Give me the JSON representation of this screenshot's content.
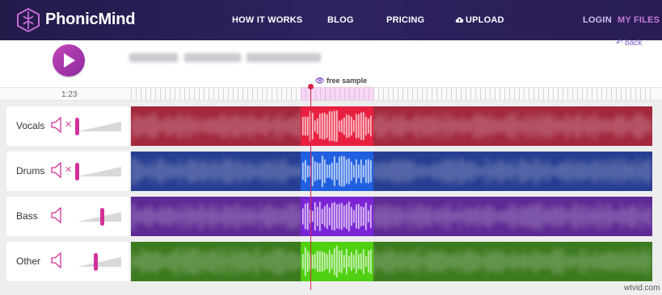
{
  "header": {
    "brand": "PhonicMind",
    "nav": {
      "how_it_works": "HOW IT WORKS",
      "blog": "BLOG",
      "pricing": "PRICING",
      "upload": "UPLOAD"
    },
    "login": "LOGIN",
    "my_files": "MY FILES"
  },
  "player": {
    "back_label": "back",
    "time": "1:23",
    "free_sample_label": "free sample"
  },
  "tracks": [
    {
      "name": "Vocals",
      "muted": true,
      "volume": 0.0,
      "base_color": "#a3283e",
      "highlight_color": "#e8203f"
    },
    {
      "name": "Drums",
      "muted": true,
      "volume": 0.0,
      "base_color": "#283e92",
      "highlight_color": "#1f5fe0"
    },
    {
      "name": "Bass",
      "muted": false,
      "volume": 0.52,
      "base_color": "#5e2a94",
      "highlight_color": "#7a24d6"
    },
    {
      "name": "Other",
      "muted": false,
      "volume": 0.4,
      "base_color": "#3c7a1e",
      "highlight_color": "#4fd010"
    }
  ],
  "watermark": "wtvid.com",
  "colors": {
    "accent": "#d2319a",
    "header": "#2e2260",
    "playhead": "#d6244a"
  }
}
